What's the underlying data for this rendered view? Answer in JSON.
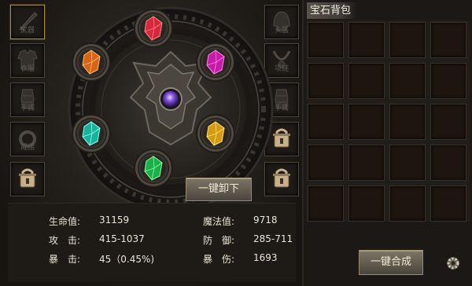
{
  "left_slots": [
    {
      "label": "武器"
    },
    {
      "label": "衣服"
    },
    {
      "label": "手镯"
    },
    {
      "label": "戒指"
    },
    {
      "label": ""
    }
  ],
  "right_slots": [
    {
      "label": "头盔"
    },
    {
      "label": "项链"
    },
    {
      "label": "手镯"
    },
    {
      "label": ""
    },
    {
      "label": ""
    }
  ],
  "gems": [
    {
      "name": "red-gem",
      "color": "#d6283a",
      "light": "#ff8a8a"
    },
    {
      "name": "magenta-gem",
      "color": "#c81aa8",
      "light": "#ff86ea"
    },
    {
      "name": "yellow-gem",
      "color": "#d49a12",
      "light": "#ffe37a"
    },
    {
      "name": "green-gem",
      "color": "#1cae48",
      "light": "#8cff9e"
    },
    {
      "name": "cyan-gem",
      "color": "#18b39a",
      "light": "#8ffff0"
    },
    {
      "name": "orange-gem",
      "color": "#d8641a",
      "light": "#ffbb6e"
    }
  ],
  "buttons": {
    "unequip": "一键卸下",
    "compose": "一键合成"
  },
  "stats": {
    "hp_label": "生命值:",
    "hp_value": "31159",
    "mp_label": "魔法值:",
    "mp_value": "9718",
    "atk_label": "攻　击:",
    "atk_value": "415-1037",
    "def_label": "防　御:",
    "def_value": "285-711",
    "crit_label": "暴　击:",
    "crit_value": "45（0.45%)",
    "critdmg_label": "暴　伤:",
    "critdmg_value": "1693"
  },
  "bag": {
    "title": "宝石背包",
    "rows": 5,
    "cols": 4
  }
}
